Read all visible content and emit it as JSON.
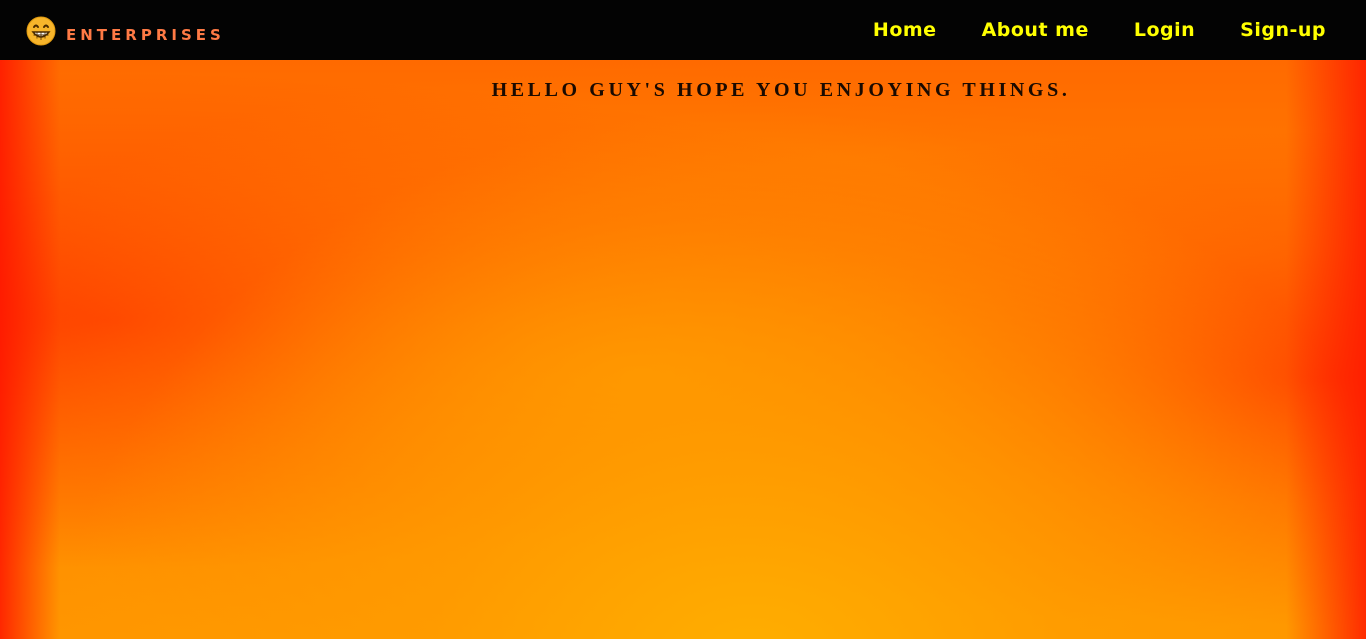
{
  "header": {
    "logo_icon": "grinning-face-icon",
    "brand": "ENTERPRISES",
    "nav": [
      {
        "label": "Home"
      },
      {
        "label": "About me"
      },
      {
        "label": "Login"
      },
      {
        "label": "Sign-up"
      }
    ]
  },
  "hero": {
    "heading": "HELLO GUY'S HOPE YOU ENJOYING THINGS."
  },
  "colors": {
    "navbar_bg": "#030303",
    "brand_text": "#ff7a45",
    "nav_text": "#ffff00",
    "hero_orange": "#ff8c00",
    "hero_red": "#ff2a00"
  }
}
